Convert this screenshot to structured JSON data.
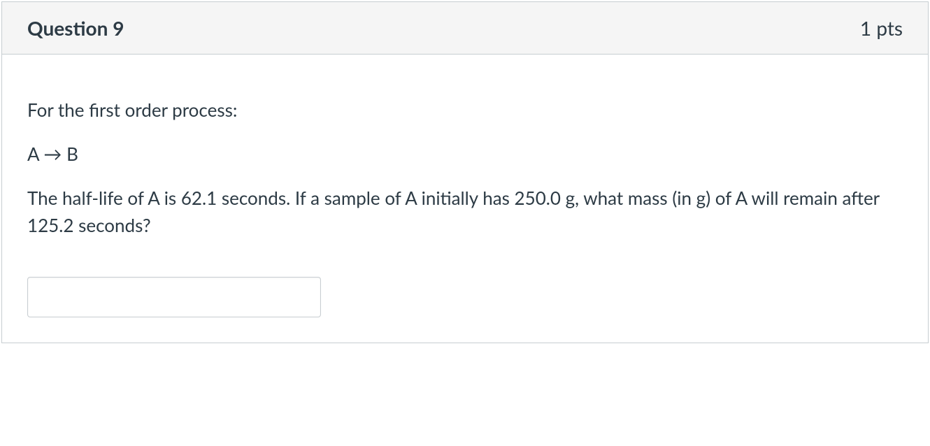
{
  "question": {
    "title": "Question 9",
    "points": "1 pts",
    "body": {
      "line1": "For the first order process:",
      "reaction_a": "A",
      "reaction_arrow": "→",
      "reaction_b": "B",
      "line3": "The half-life of A is 62.1 seconds.  If a sample of A initially has 250.0 g, what mass (in g) of A will remain after 125.2 seconds?"
    },
    "answer_value": ""
  }
}
